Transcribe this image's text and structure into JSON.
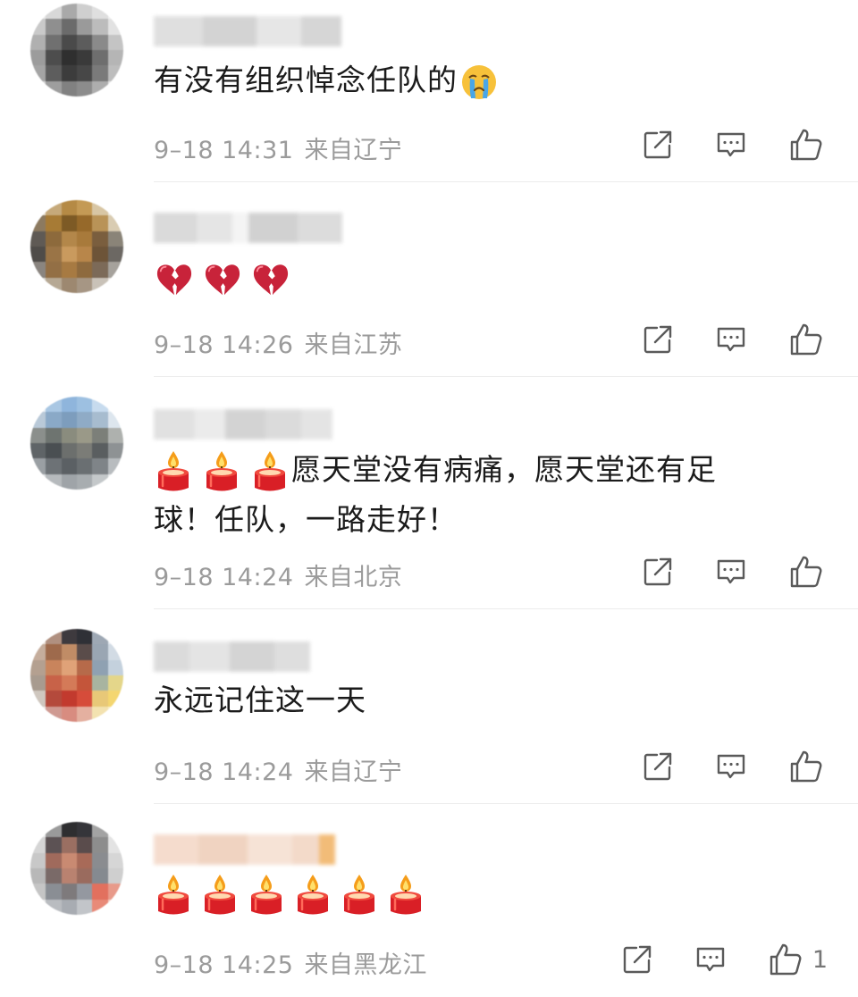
{
  "comments": [
    {
      "text": "有没有组织悼念任队的",
      "emojis": [
        "crying-face"
      ],
      "time": "9–18 14:31",
      "location": "来自辽宁",
      "like_count": ""
    },
    {
      "text": "",
      "emojis": [
        "broken-heart",
        "broken-heart",
        "broken-heart"
      ],
      "time": "9–18 14:26",
      "location": "来自江苏",
      "like_count": ""
    },
    {
      "text_line1": "愿天堂没有病痛，愿天堂还有足",
      "text_line2": "球！任队，一路走好！",
      "emojis": [
        "candle",
        "candle",
        "candle"
      ],
      "time": "9–18 14:24",
      "location": "来自北京",
      "like_count": ""
    },
    {
      "text": "永远记住这一天",
      "emojis": [],
      "time": "9–18 14:24",
      "location": "来自辽宁",
      "like_count": ""
    },
    {
      "text": "",
      "emojis": [
        "candle",
        "candle",
        "candle",
        "candle",
        "candle",
        "candle"
      ],
      "time": "9–18 14:25",
      "location": "来自黑龙江",
      "like_count": "1"
    }
  ],
  "icons": {
    "share": "share-icon",
    "comment": "comment-icon",
    "like": "thumbs-up-icon"
  }
}
